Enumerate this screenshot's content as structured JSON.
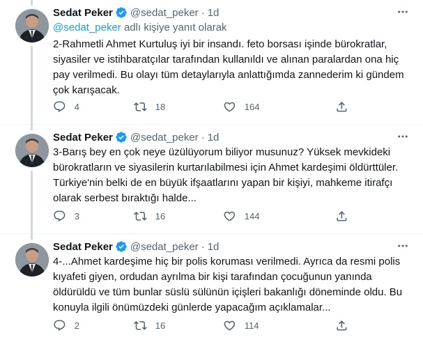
{
  "tweets": [
    {
      "author_name": "Sedat Peker",
      "handle": "@sedat_peker",
      "separator": "·",
      "time": "1d",
      "reply_mention": "@sedat_peker",
      "reply_suffix": " adlı kişiye yanıt olarak",
      "text": "2-Rahmetli Ahmet Kurtuluş iyi bir insandı. feto borsası işinde bürokratlar,\nsiyasiler ve istihbaratçılar tarafından kullanıldı ve alınan paralardan ona hiç\npay verilmedi. Bu olayı tüm detaylarıyla anlattığımda zannederim ki gündem\nçok karışacak.",
      "replies": "4",
      "retweets": "18",
      "likes": "164"
    },
    {
      "author_name": "Sedat Peker",
      "handle": "@sedat_peker",
      "separator": "·",
      "time": "1d",
      "text": "3-Barış bey en çok neye üzülüyorum biliyor musunuz? Yüksek mevkideki\nbürokratların ve siyasilerin kurtarılabilmesi için Ahmet kardeşimi öldürttüler.\nTürkiye'nin belki de en büyük ifşaatlarını yapan bir kişiyi, mahkeme itirafçı\nolarak serbest bıraktığı halde...",
      "replies": "3",
      "retweets": "16",
      "likes": "144"
    },
    {
      "author_name": "Sedat Peker",
      "handle": "@sedat_peker",
      "separator": "·",
      "time": "1d",
      "text": "4-...Ahmet kardeşime hiç bir polis koruması verilmedi. Ayrıca da resmi polis\nkıyafeti giyen, ordudan ayrılma bir kişi tarafından çocuğunun yanında\nöldürüldü ve tüm bunlar süslü sülünün içişleri bakanlığı döneminde oldu. Bu\nkonuyla ilgili önümüzdeki günlerde yapacağım açıklamalar...",
      "replies": "2",
      "retweets": "16",
      "likes": "114"
    }
  ],
  "colors": {
    "accent": "#1d9bf0",
    "secondary_text": "#536471",
    "primary_text": "#0f1419",
    "thread_line": "#cfd9de"
  },
  "icons": [
    "verified-badge-icon",
    "more-icon",
    "reply-icon",
    "retweet-icon",
    "like-icon",
    "share-icon"
  ]
}
